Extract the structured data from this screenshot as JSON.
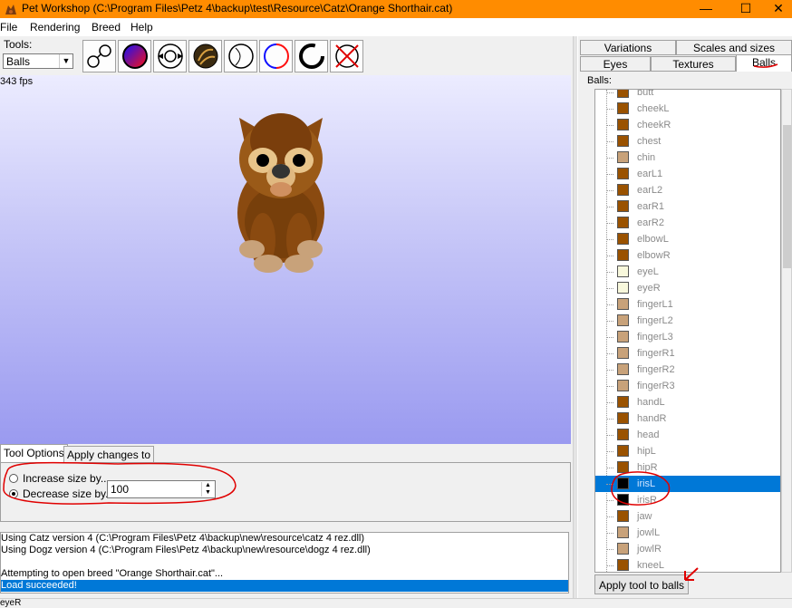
{
  "window": {
    "title": "Pet Workshop (C:\\Program Files\\Petz 4\\backup\\test\\Resource\\Catz\\Orange Shorthair.cat)",
    "minimize": "—",
    "maximize": "☐",
    "close": "✕"
  },
  "menu": [
    "File",
    "Rendering",
    "Breed",
    "Help"
  ],
  "tools": {
    "label": "Tools:",
    "selected": "Balls",
    "buttons": [
      "connect-tool",
      "color-tool",
      "move-tool",
      "texture-tool",
      "outline-tool",
      "circle-tool",
      "thick-outline-tool",
      "delete-tool"
    ]
  },
  "fps": "343 fps",
  "bottom_tabs": [
    "Tool Options",
    "Apply changes to"
  ],
  "tool_options": {
    "increase_label": "Increase size by...",
    "decrease_label": "Decrease size by...",
    "selected_option": "decrease",
    "amount": "100"
  },
  "log": [
    "Using Catz version 4 (C:\\Program Files\\Petz 4\\backup\\new\\resource\\catz 4 rez.dll)",
    "Using Dogz version 4 (C:\\Program Files\\Petz 4\\backup\\new\\resource\\dogz 4 rez.dll)",
    "",
    "Attempting to open breed \"Orange Shorthair.cat\"...",
    "Load succeeded!"
  ],
  "status": "eyeR",
  "right_tabs": {
    "row1": [
      "Variations",
      "Scales and sizes"
    ],
    "row2": [
      "Eyes",
      "Textures",
      "Balls"
    ],
    "active": "Balls"
  },
  "balls_label": "Balls:",
  "balls": [
    {
      "name": "butt",
      "color": "#9a5200"
    },
    {
      "name": "cheekL",
      "color": "#9a5200"
    },
    {
      "name": "cheekR",
      "color": "#9a5200"
    },
    {
      "name": "chest",
      "color": "#9a5200"
    },
    {
      "name": "chin",
      "color": "#c8a27a"
    },
    {
      "name": "earL1",
      "color": "#9a5200"
    },
    {
      "name": "earL2",
      "color": "#9a5200"
    },
    {
      "name": "earR1",
      "color": "#9a5200"
    },
    {
      "name": "earR2",
      "color": "#9a5200"
    },
    {
      "name": "elbowL",
      "color": "#9a5200"
    },
    {
      "name": "elbowR",
      "color": "#9a5200"
    },
    {
      "name": "eyeL",
      "color": "#f8f8dc"
    },
    {
      "name": "eyeR",
      "color": "#f8f8dc"
    },
    {
      "name": "fingerL1",
      "color": "#c8a27a"
    },
    {
      "name": "fingerL2",
      "color": "#c8a27a"
    },
    {
      "name": "fingerL3",
      "color": "#c8a27a"
    },
    {
      "name": "fingerR1",
      "color": "#c8a27a"
    },
    {
      "name": "fingerR2",
      "color": "#c8a27a"
    },
    {
      "name": "fingerR3",
      "color": "#c8a27a"
    },
    {
      "name": "handL",
      "color": "#9a5200"
    },
    {
      "name": "handR",
      "color": "#9a5200"
    },
    {
      "name": "head",
      "color": "#9a5200"
    },
    {
      "name": "hipL",
      "color": "#9a5200"
    },
    {
      "name": "hipR",
      "color": "#9a5200"
    },
    {
      "name": "irisL",
      "color": "#000000"
    },
    {
      "name": "irisR",
      "color": "#000000"
    },
    {
      "name": "jaw",
      "color": "#9a5200"
    },
    {
      "name": "jowlL",
      "color": "#c8a27a"
    },
    {
      "name": "jowlR",
      "color": "#c8a27a"
    },
    {
      "name": "kneeL",
      "color": "#9a5200"
    }
  ],
  "selected_ball": "irisL",
  "apply_button": "Apply tool to balls",
  "colors": {
    "titlebar": "#ff8c00",
    "selection": "#0078d7",
    "annotation": "#e00000"
  }
}
